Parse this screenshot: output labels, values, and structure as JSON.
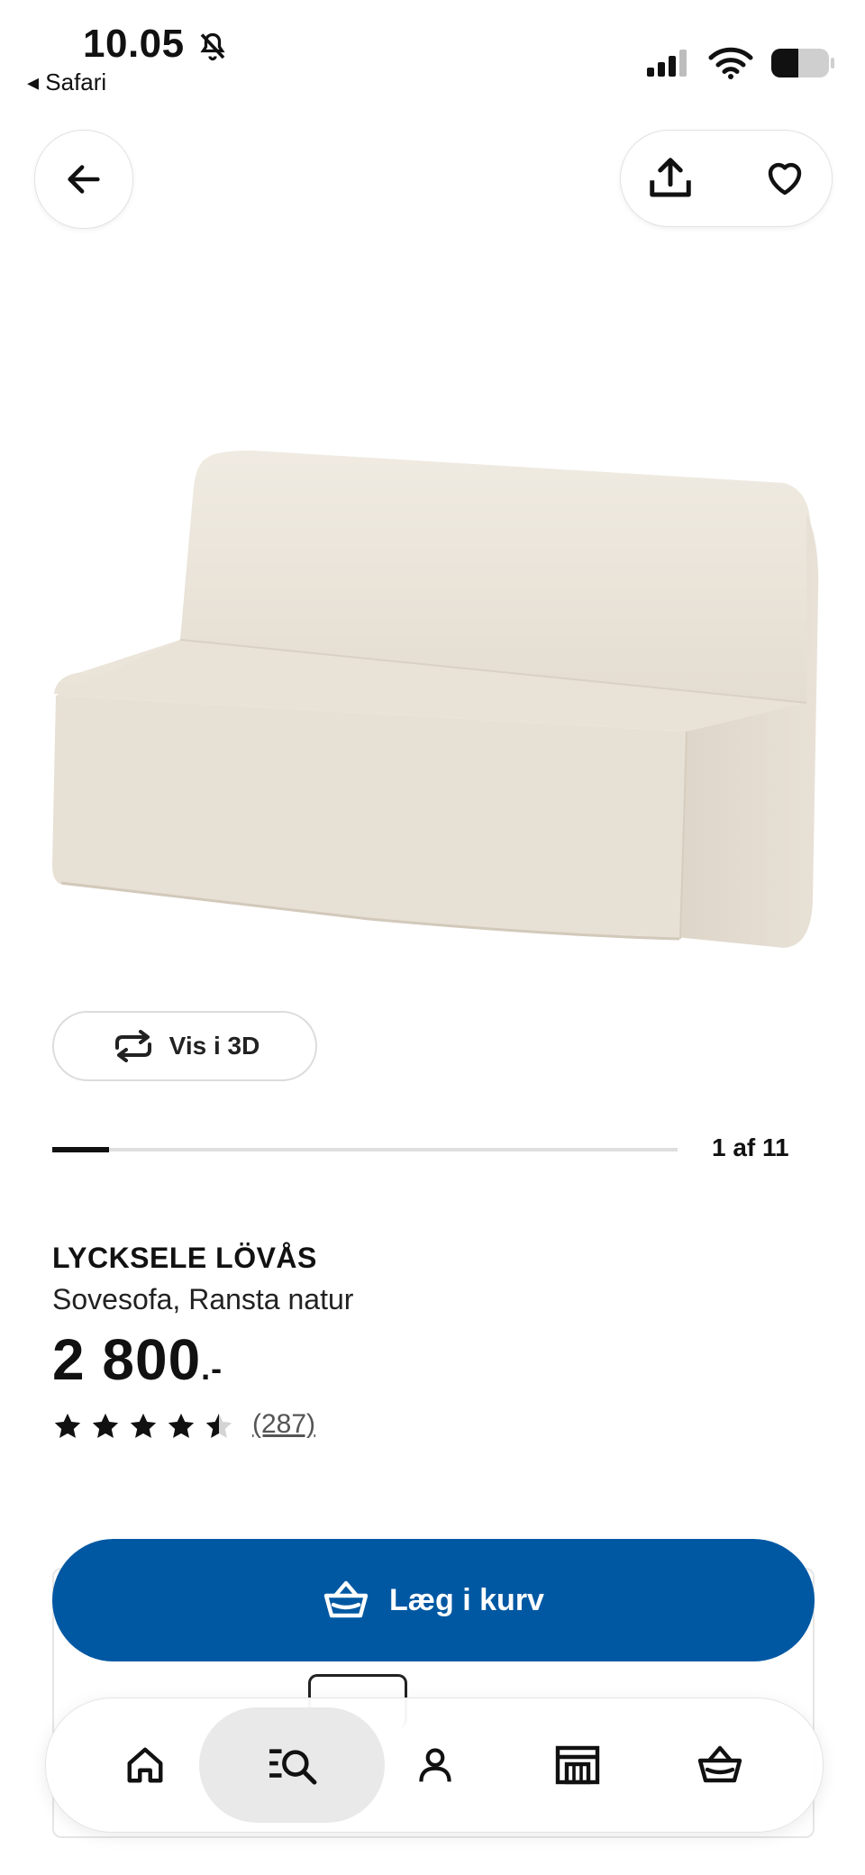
{
  "status_bar": {
    "time": "10.05",
    "back_app": "◂ Safari"
  },
  "gallery": {
    "view_3d_label": "Vis i 3D",
    "counter": "1 af 11",
    "current_index": 1,
    "total": 11
  },
  "product": {
    "name": "LYCKSELE LÖVÅS",
    "description": "Sovesofa, Ransta natur",
    "price": "2 800",
    "price_suffix": ".-",
    "rating": 4.5,
    "rating_max": 5,
    "review_count": "(287)"
  },
  "actions": {
    "add_to_cart_label": "Læg i kurv"
  },
  "icons": {
    "back": "arrow-left-icon",
    "share": "share-icon",
    "favorite": "heart-icon",
    "rotate": "rotate-3d-icon",
    "cart": "basket-icon",
    "nav_home": "home-icon",
    "nav_search": "search-list-icon",
    "nav_profile": "user-icon",
    "nav_store": "store-icon",
    "nav_cart": "basket-icon"
  },
  "colors": {
    "brand_blue": "#0058a3",
    "sofa_fabric": "#ece5da"
  },
  "bottom_nav": {
    "active": "search"
  }
}
